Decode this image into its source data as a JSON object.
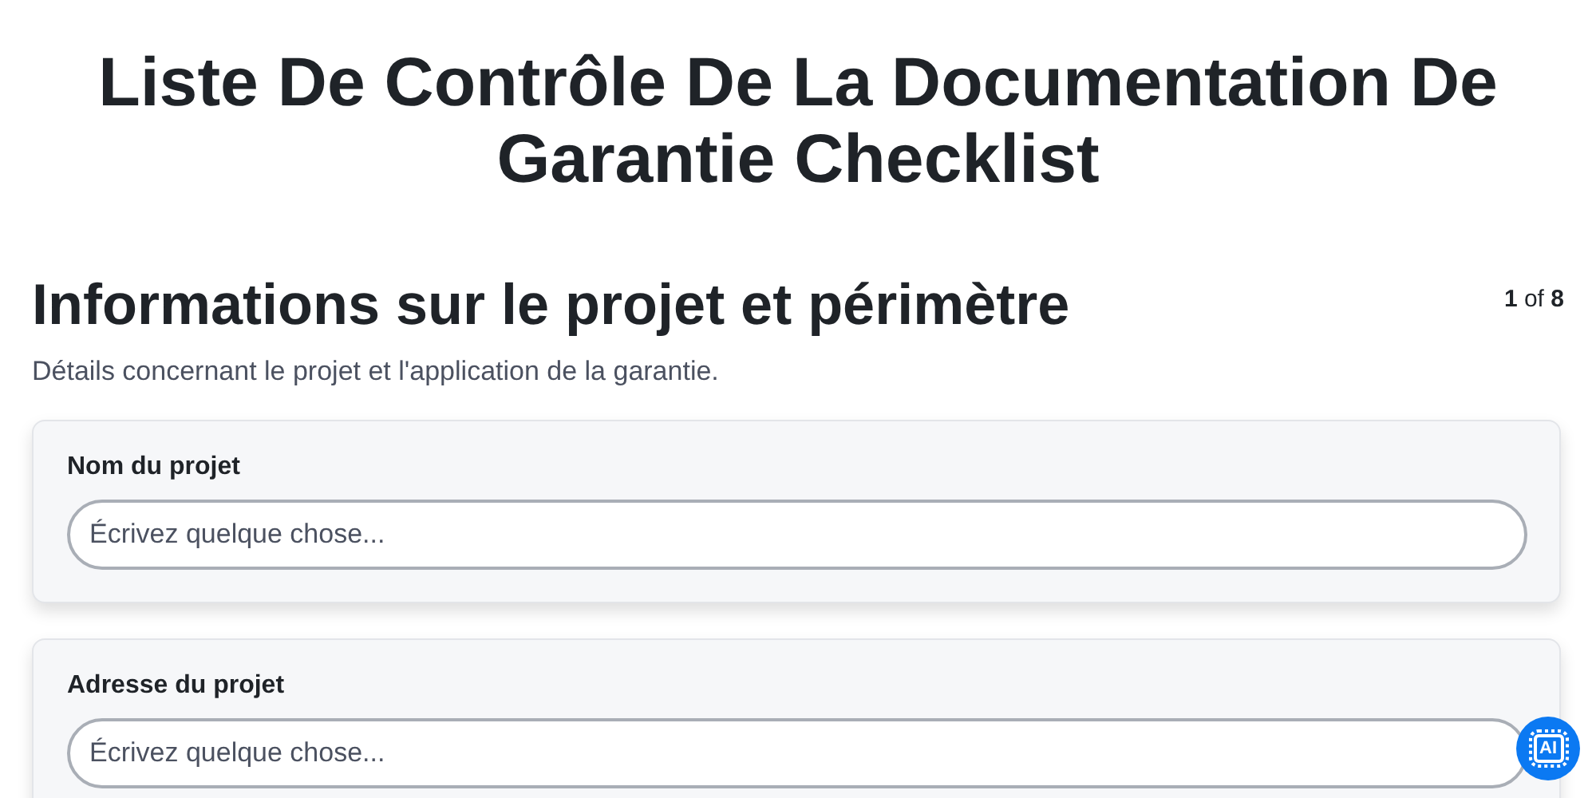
{
  "title": "Liste De Contrôle De La Documentation De Garantie Checklist",
  "section": {
    "heading": "Informations sur le projet et périmètre",
    "pager": "**1** of **8**",
    "description": "Détails concernant le projet et l'application de la garantie."
  },
  "fields": [
    {
      "label": "Nom du projet",
      "placeholder": "Écrivez quelque chose..."
    },
    {
      "label": "Adresse du projet",
      "placeholder": "Écrivez quelque chose..."
    }
  ],
  "ai_button": {
    "label": "AI"
  }
}
